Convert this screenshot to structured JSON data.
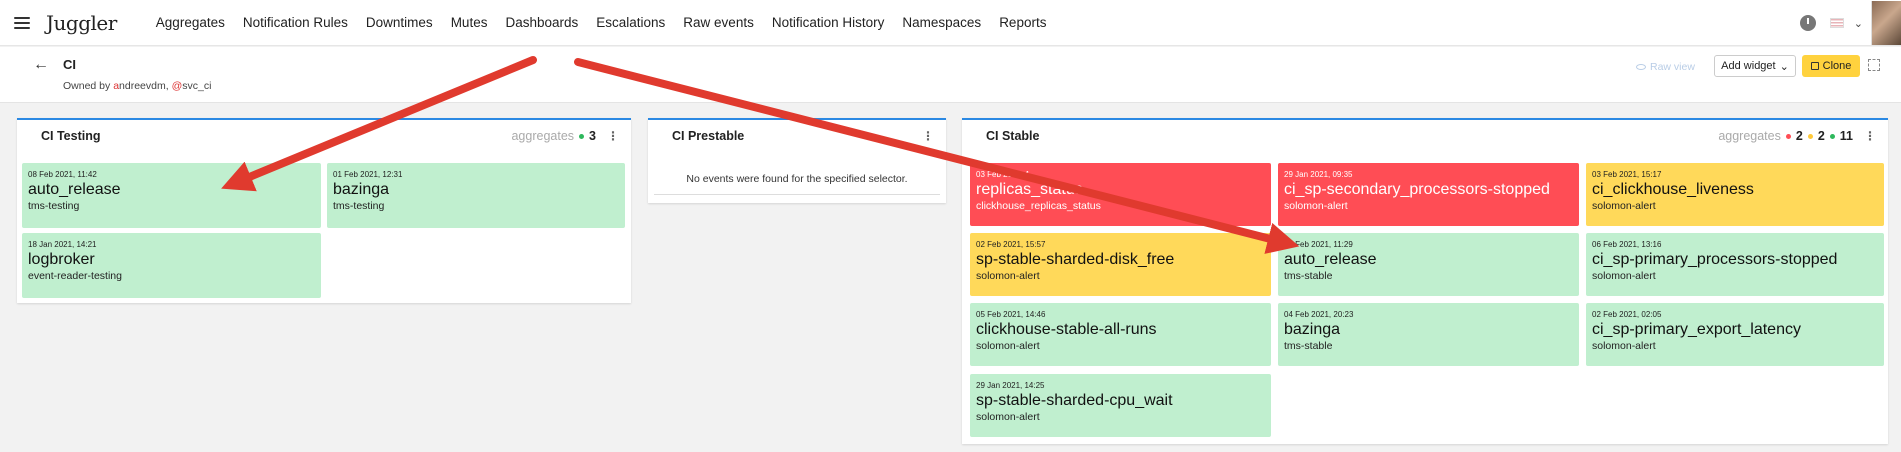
{
  "app": {
    "logo": "Juggler"
  },
  "nav": [
    "Aggregates",
    "Notification Rules",
    "Downtimes",
    "Mutes",
    "Dashboards",
    "Escalations",
    "Raw events",
    "Notification History",
    "Namespaces",
    "Reports"
  ],
  "header": {
    "back": "←",
    "title": "CI",
    "owned_prefix": "Owned by ",
    "owner1_first": "a",
    "owner1_rest": "ndreevdm",
    "sep": ", ",
    "owner2_first": "@",
    "owner2_rest": "svc_ci",
    "raw_view": "Raw view",
    "add_widget": "Add widget",
    "add_widget_caret": "⌄",
    "clone": "Clone"
  },
  "colors": {
    "ok": "#c0efcf",
    "crit": "#ff4d55",
    "warn": "#ffd95a",
    "accent": "#2b89e3"
  },
  "widgets": {
    "testing": {
      "title": "CI Testing",
      "agg_label": "aggregates",
      "counts": [
        {
          "color": "#2eb85c",
          "value": "3"
        }
      ],
      "cards": [
        {
          "ts": "08 Feb 2021, 11:42",
          "name": "auto_release",
          "sub": "tms-testing",
          "status": "ok"
        },
        {
          "ts": "01 Feb 2021, 12:31",
          "name": "bazinga",
          "sub": "tms-testing",
          "status": "ok"
        },
        {
          "ts": "18 Jan 2021, 14:21",
          "name": "logbroker",
          "sub": "event-reader-testing",
          "status": "ok"
        }
      ]
    },
    "prestable": {
      "title": "CI Prestable",
      "empty": "No events were found for the specified selector."
    },
    "stable": {
      "title": "CI Stable",
      "agg_label": "aggregates",
      "counts": [
        {
          "color": "#ff4d55",
          "value": "2"
        },
        {
          "color": "#ffc93a",
          "value": "2"
        },
        {
          "color": "#2eb85c",
          "value": "11"
        }
      ],
      "cards": [
        {
          "ts": "03 Feb 2021, 1",
          "name": "replicas_status",
          "sub": "clickhouse_replicas_status",
          "status": "crit"
        },
        {
          "ts": "29 Jan 2021, 09:35",
          "name": "ci_sp-secondary_processors-stopped",
          "sub": "solomon-alert",
          "status": "crit"
        },
        {
          "ts": "03 Feb 2021, 15:17",
          "name": "ci_clickhouse_liveness",
          "sub": "solomon-alert",
          "status": "warn"
        },
        {
          "ts": "02 Feb 2021, 15:57",
          "name": "sp-stable-sharded-disk_free",
          "sub": "solomon-alert",
          "status": "warn"
        },
        {
          "ts": "08 Feb 2021, 11:29",
          "name": "auto_release",
          "sub": "tms-stable",
          "status": "ok"
        },
        {
          "ts": "06 Feb 2021, 13:16",
          "name": "ci_sp-primary_processors-stopped",
          "sub": "solomon-alert",
          "status": "ok"
        },
        {
          "ts": "05 Feb 2021, 14:46",
          "name": "clickhouse-stable-all-runs",
          "sub": "solomon-alert",
          "status": "ok"
        },
        {
          "ts": "04 Feb 2021, 20:23",
          "name": "bazinga",
          "sub": "tms-stable",
          "status": "ok"
        },
        {
          "ts": "02 Feb 2021, 02:05",
          "name": "ci_sp-primary_export_latency",
          "sub": "solomon-alert",
          "status": "ok"
        },
        {
          "ts": "29 Jan 2021, 14:25",
          "name": "sp-stable-sharded-cpu_wait",
          "sub": "solomon-alert",
          "status": "ok"
        }
      ]
    }
  },
  "annotation": {
    "arrow_color": "#e03a2e"
  }
}
